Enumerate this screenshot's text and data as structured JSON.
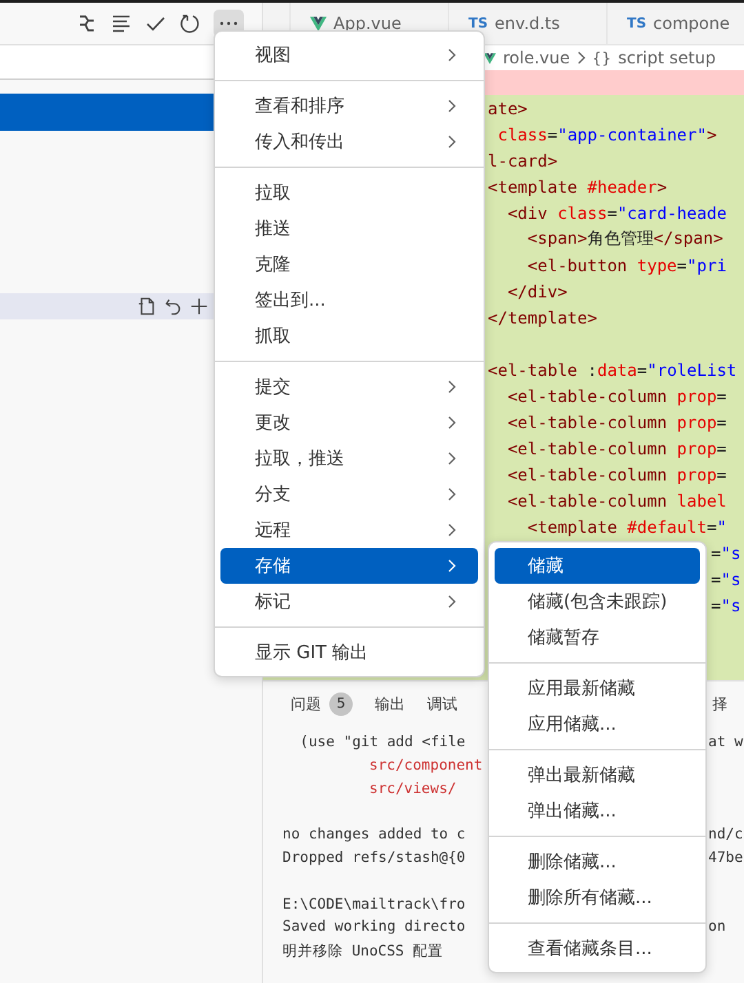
{
  "source_control": {
    "toolbar": [
      {
        "kind": "graph"
      },
      {
        "kind": "list"
      },
      {
        "kind": "check"
      },
      {
        "kind": "refresh"
      },
      {
        "kind": "more",
        "selected": true
      }
    ],
    "file_row_icons": [
      {
        "kind": "doc"
      },
      {
        "kind": "undo"
      },
      {
        "kind": "plus"
      }
    ]
  },
  "editor_tabs": [
    {
      "kind": "vue",
      "label": "App.vue"
    },
    {
      "kind": "ts",
      "icon_text": "TS",
      "label": "env.d.ts"
    },
    {
      "kind": "ts",
      "icon_text": "TS",
      "label": "compone"
    }
  ],
  "breadcrumb": {
    "file": "role.vue",
    "symbol_icon": "{}",
    "symbol": "script setup"
  },
  "code_lines": [
    {
      "segments": [
        {
          "kind": "tag",
          "text": "ate>"
        }
      ]
    },
    {
      "segments": [
        {
          "kind": "attr",
          "text": " class"
        },
        {
          "kind": "plain",
          "text": "="
        },
        {
          "kind": "str",
          "text": "\"app-container\""
        },
        {
          "kind": "tag",
          "text": ">"
        }
      ]
    },
    {
      "segments": [
        {
          "kind": "tag",
          "text": "l-card>"
        }
      ]
    },
    {
      "segments": [
        {
          "kind": "tag",
          "text": "<template"
        },
        {
          "kind": "attr",
          "text": " #header"
        },
        {
          "kind": "tag",
          "text": ">"
        }
      ]
    },
    {
      "segments": [
        {
          "kind": "tag",
          "text": "  <div"
        },
        {
          "kind": "attr",
          "text": " class"
        },
        {
          "kind": "plain",
          "text": "="
        },
        {
          "kind": "str",
          "text": "\"card-heade"
        }
      ]
    },
    {
      "segments": [
        {
          "kind": "tag",
          "text": "    <span>"
        },
        {
          "kind": "plain",
          "text": "角色管理"
        },
        {
          "kind": "tag",
          "text": "</span>"
        }
      ]
    },
    {
      "segments": [
        {
          "kind": "tag",
          "text": "    <el-button"
        },
        {
          "kind": "attr",
          "text": " type"
        },
        {
          "kind": "plain",
          "text": "="
        },
        {
          "kind": "str",
          "text": "\"pri"
        }
      ]
    },
    {
      "segments": [
        {
          "kind": "tag",
          "text": "  </div>"
        }
      ]
    },
    {
      "segments": [
        {
          "kind": "tag",
          "text": "</template>"
        }
      ]
    },
    {
      "gap_before": true,
      "segments": [
        {
          "kind": "tag",
          "text": "<el-table"
        },
        {
          "kind": "plain",
          "text": " :"
        },
        {
          "kind": "attr",
          "text": "data"
        },
        {
          "kind": "plain",
          "text": "="
        },
        {
          "kind": "str",
          "text": "\"roleList"
        }
      ]
    },
    {
      "segments": [
        {
          "kind": "tag",
          "text": "  <el-table-column"
        },
        {
          "kind": "attr",
          "text": " prop"
        },
        {
          "kind": "plain",
          "text": "="
        }
      ]
    },
    {
      "segments": [
        {
          "kind": "tag",
          "text": "  <el-table-column"
        },
        {
          "kind": "attr",
          "text": " prop"
        },
        {
          "kind": "plain",
          "text": "="
        }
      ]
    },
    {
      "segments": [
        {
          "kind": "tag",
          "text": "  <el-table-column"
        },
        {
          "kind": "attr",
          "text": " prop"
        },
        {
          "kind": "plain",
          "text": "="
        }
      ]
    },
    {
      "segments": [
        {
          "kind": "tag",
          "text": "  <el-table-column"
        },
        {
          "kind": "attr",
          "text": " prop"
        },
        {
          "kind": "plain",
          "text": "="
        }
      ]
    },
    {
      "segments": [
        {
          "kind": "tag",
          "text": "  <el-table-column"
        },
        {
          "kind": "attr",
          "text": " label"
        }
      ]
    },
    {
      "segments": [
        {
          "kind": "tag",
          "text": "    <template"
        },
        {
          "kind": "attr",
          "text": " #default"
        },
        {
          "kind": "plain",
          "text": "="
        },
        {
          "kind": "str",
          "text": "\""
        }
      ]
    },
    {
      "after_submenu": true,
      "segments": [
        {
          "kind": "plain",
          "text": "="
        },
        {
          "kind": "str",
          "text": "\"s"
        }
      ]
    },
    {
      "after_submenu": true,
      "segments": [
        {
          "kind": "plain",
          "text": "="
        },
        {
          "kind": "str",
          "text": "\"s"
        }
      ]
    },
    {
      "after_submenu": true,
      "segments": [
        {
          "kind": "plain",
          "text": "="
        },
        {
          "kind": "str",
          "text": "\"s"
        }
      ]
    }
  ],
  "panel_tabs": [
    {
      "label": "问题",
      "badge": "5"
    },
    {
      "label": "输出"
    },
    {
      "label": "调试"
    }
  ],
  "panel_tab_tail": "择",
  "terminal_lines": [
    {
      "kind": "plain",
      "text": "  (use \"git add <file",
      "tail": "at w"
    },
    {
      "kind": "path",
      "text": "src/component"
    },
    {
      "kind": "path",
      "text": "src/views/"
    },
    {
      "kind": "plain",
      "gap_before": true,
      "text": "no changes added to c",
      "tail": "nd/c"
    },
    {
      "kind": "plain",
      "text": "Dropped refs/stash@{0",
      "tail": "47be"
    },
    {
      "kind": "plain",
      "gap_before": true,
      "text": "E:\\CODE\\mailtrack\\fro"
    },
    {
      "kind": "plain",
      "text": "Saved working directo",
      "tail": "on"
    },
    {
      "kind": "plain",
      "text": "明并移除 UnoCSS 配置"
    }
  ],
  "menu": {
    "groups": [
      [
        {
          "label": "视图",
          "kind": "submenu",
          "selected": false
        }
      ],
      [
        {
          "label": "查看和排序",
          "kind": "submenu",
          "selected": false
        },
        {
          "label": "传入和传出",
          "kind": "submenu",
          "selected": false
        }
      ],
      [
        {
          "label": "拉取",
          "kind": "action",
          "selected": false
        },
        {
          "label": "推送",
          "kind": "action",
          "selected": false
        },
        {
          "label": "克隆",
          "kind": "action",
          "selected": false
        },
        {
          "label": "签出到...",
          "kind": "action",
          "selected": false
        },
        {
          "label": "抓取",
          "kind": "action",
          "selected": false
        }
      ],
      [
        {
          "label": "提交",
          "kind": "submenu",
          "selected": false
        },
        {
          "label": "更改",
          "kind": "submenu",
          "selected": false
        },
        {
          "label": "拉取，推送",
          "kind": "submenu",
          "selected": false
        },
        {
          "label": "分支",
          "kind": "submenu",
          "selected": false
        },
        {
          "label": "远程",
          "kind": "submenu",
          "selected": false
        },
        {
          "label": "存储",
          "kind": "submenu",
          "selected": true
        },
        {
          "label": "标记",
          "kind": "submenu",
          "selected": false
        }
      ],
      [
        {
          "label": "显示 GIT 输出",
          "kind": "action",
          "selected": false
        }
      ]
    ]
  },
  "submenu": {
    "groups": [
      [
        {
          "label": "储藏",
          "selected": true
        },
        {
          "label": "储藏(包含未跟踪)",
          "selected": false
        },
        {
          "label": "储藏暂存",
          "selected": false
        }
      ],
      [
        {
          "label": "应用最新储藏",
          "selected": false
        },
        {
          "label": "应用储藏...",
          "selected": false
        }
      ],
      [
        {
          "label": "弹出最新储藏",
          "selected": false
        },
        {
          "label": "弹出储藏...",
          "selected": false
        }
      ],
      [
        {
          "label": "删除储藏...",
          "selected": false
        },
        {
          "label": "删除所有储藏...",
          "selected": false
        }
      ],
      [
        {
          "label": "查看储藏条目...",
          "selected": false
        }
      ]
    ]
  }
}
